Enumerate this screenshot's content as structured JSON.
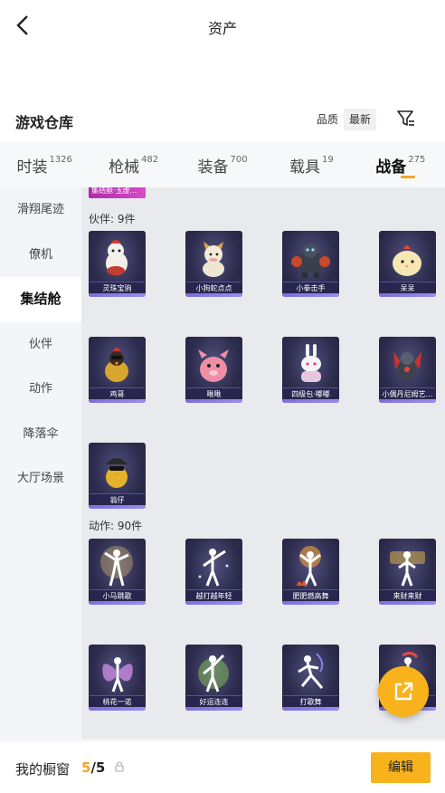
{
  "header": {
    "title": "资产"
  },
  "section": {
    "title": "游戏仓库",
    "sort_options": [
      "品质",
      "最新"
    ],
    "active_sort": 1
  },
  "tabs": [
    {
      "label": "时装",
      "count": "1326"
    },
    {
      "label": "枪械",
      "count": "482"
    },
    {
      "label": "装备",
      "count": "700"
    },
    {
      "label": "载具",
      "count": "19"
    },
    {
      "label": "战备",
      "count": "275"
    }
  ],
  "active_tab": 4,
  "sidebar": {
    "items": [
      "滑翔尾迹",
      "僚机",
      "集结舱",
      "伙伴",
      "动作",
      "降落伞",
      "大厅场景"
    ],
    "active": 2
  },
  "content": {
    "top_tag": "集结舱·玉虚…",
    "companions": {
      "label": "伙伴: 9件",
      "items": [
        "灵珠宝驹",
        "小狗蛇点点",
        "小拳击手",
        "呆呆",
        "鸡哥",
        "啾啾",
        "四级包·嘟嘟",
        "小偶丹尼姆艺…",
        "翁仔"
      ]
    },
    "emotes": {
      "label": "动作: 90件",
      "items": [
        "小马跳歌",
        "越打越年轻",
        "肥肥燃高舞",
        "来财来财",
        "桃花一诺",
        "好运连连",
        "打歌舞",
        ""
      ]
    }
  },
  "bottom": {
    "label": "我的橱窗",
    "current": "5",
    "total": "/5",
    "edit_label": "编辑"
  },
  "colors": {
    "accent": "#f7b21c",
    "active_underline": "#f5a623",
    "card_bg": "#2d2c4e"
  }
}
